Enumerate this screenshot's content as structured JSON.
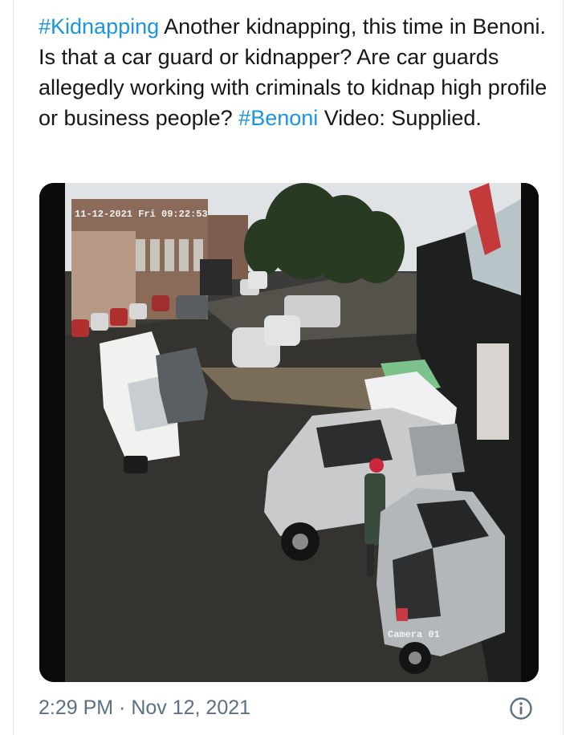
{
  "tweet": {
    "hashtag_1": "#Kidnapping",
    "text_1": " Another kidnapping, this time in Benoni. Is that a car guard or kidnapper? Are car guards allegedly working with criminals to kidnap high profile or business people? ",
    "hashtag_2": "#Benoni",
    "text_2": " Video: Supplied."
  },
  "video": {
    "cctv_timestamp": "11-12-2021 Fri 09:22:53",
    "camera_label": "Camera 01"
  },
  "meta": {
    "timestamp": "2:29 PM · Nov 12, 2021",
    "info_icon": "info-icon"
  },
  "colors": {
    "hashtag": "#1b95e0",
    "text": "#14171a",
    "meta": "#5b7083"
  }
}
